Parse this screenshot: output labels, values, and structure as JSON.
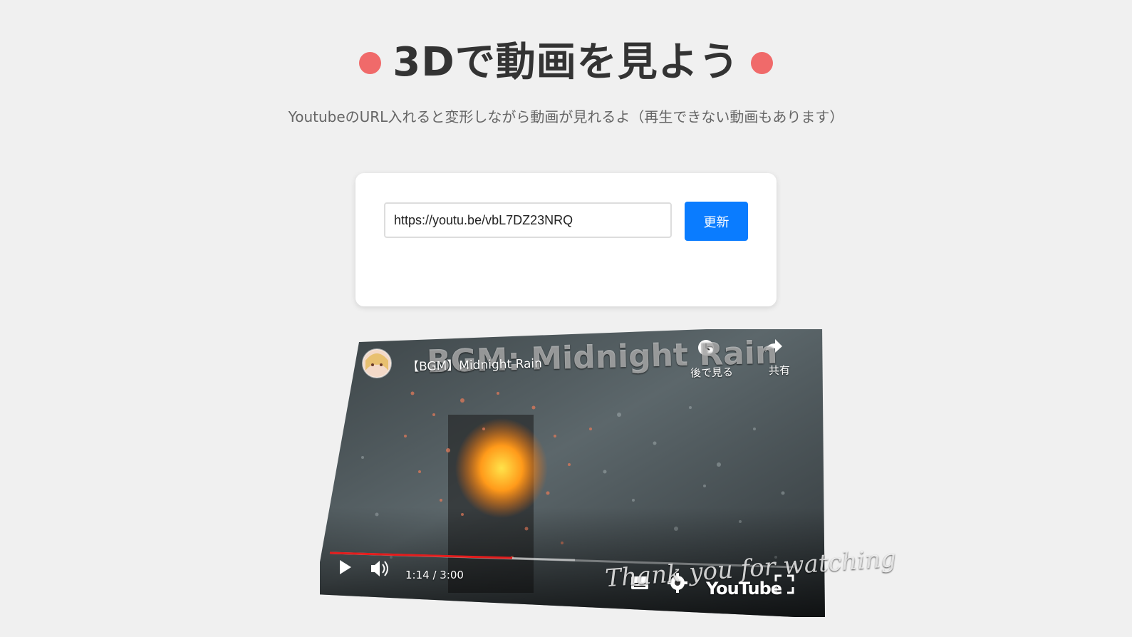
{
  "header": {
    "title": "3Dで動画を見よう",
    "subtitle": "YoutubeのURL入れると変形しながら動画が見れるよ（再生できない動画もあります）",
    "dot_color": "#f06a6a"
  },
  "form": {
    "url_value": "https://youtu.be/vbL7DZ23NRQ",
    "update_label": "更新",
    "button_color": "#0a7cff"
  },
  "video": {
    "title": "【BGM】Midnight Rain",
    "overlay_title": "BGM: Midnight Rain",
    "watch_later_label": "後で見る",
    "share_label": "共有",
    "time": "1:14 / 3:00",
    "progress": 0.41,
    "buffered": 0.55,
    "end_text": "Thank you for watching",
    "brand": "YouTube",
    "progress_color": "#e31c1c"
  }
}
